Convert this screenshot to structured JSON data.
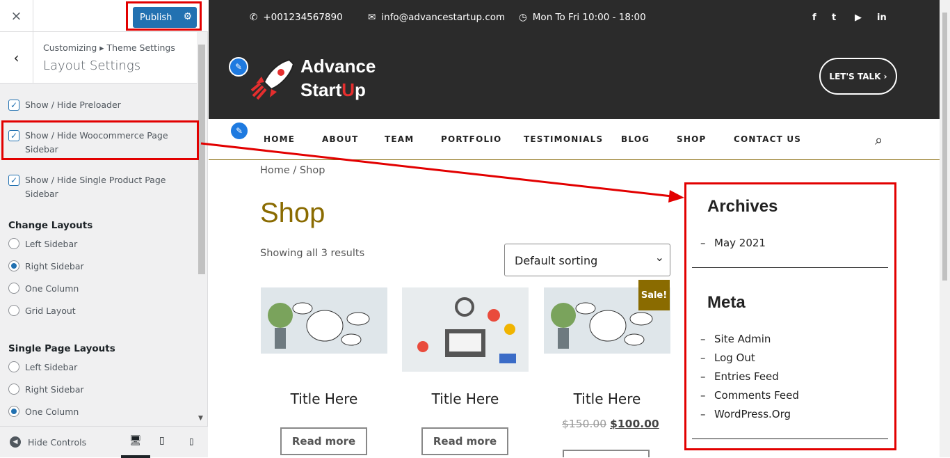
{
  "panel": {
    "close_icon": "×",
    "publish": "Publish",
    "breadcrumb": "Customizing ▸ Theme Settings",
    "title": "Layout Settings",
    "checkboxes": [
      {
        "label": "Show / Hide Preloader"
      },
      {
        "label": "Show / Hide Woocommerce Page Sidebar"
      },
      {
        "label": "Show / Hide Single Product Page Sidebar"
      }
    ],
    "change_layouts": {
      "heading": "Change Layouts",
      "options": [
        "Left Sidebar",
        "Right Sidebar",
        "One Column",
        "Grid Layout"
      ],
      "selected": "Right Sidebar"
    },
    "single_layouts": {
      "heading": "Single Page Layouts",
      "options": [
        "Left Sidebar",
        "Right Sidebar",
        "One Column"
      ],
      "selected": "One Column"
    },
    "hide_controls": "Hide Controls"
  },
  "site": {
    "phone": "+001234567890",
    "email": "info@advancestartup.com",
    "hours": "Mon To Fri 10:00 - 18:00",
    "social": [
      "f",
      "t",
      "▶",
      "in"
    ],
    "logo_line1": "Advance",
    "logo_line2a": "Start",
    "logo_line2b": "U",
    "logo_line2c": "p",
    "cta": "LET'S TALK ›",
    "nav": [
      "HOME",
      "ABOUT",
      "TEAM",
      "PORTFOLIO",
      "TESTIMONIALS",
      "BLOG",
      "SHOP",
      "CONTACT US"
    ],
    "breadcrumb": "Home / Shop",
    "heading": "Shop",
    "results": "Showing all 3 results",
    "sorting": "Default sorting",
    "products": [
      {
        "title": "Title Here",
        "button": "Read more"
      },
      {
        "title": "Title Here",
        "button": "Read more"
      },
      {
        "title": "Title Here",
        "old_price": "$150.00",
        "price": "$100.00",
        "badge": "Sale!"
      }
    ],
    "sidebar": {
      "archives_title": "Archives",
      "archives": [
        "May 2021"
      ],
      "meta_title": "Meta",
      "meta": [
        "Site Admin",
        "Log Out",
        "Entries Feed",
        "Comments Feed",
        "WordPress.Org"
      ]
    }
  }
}
